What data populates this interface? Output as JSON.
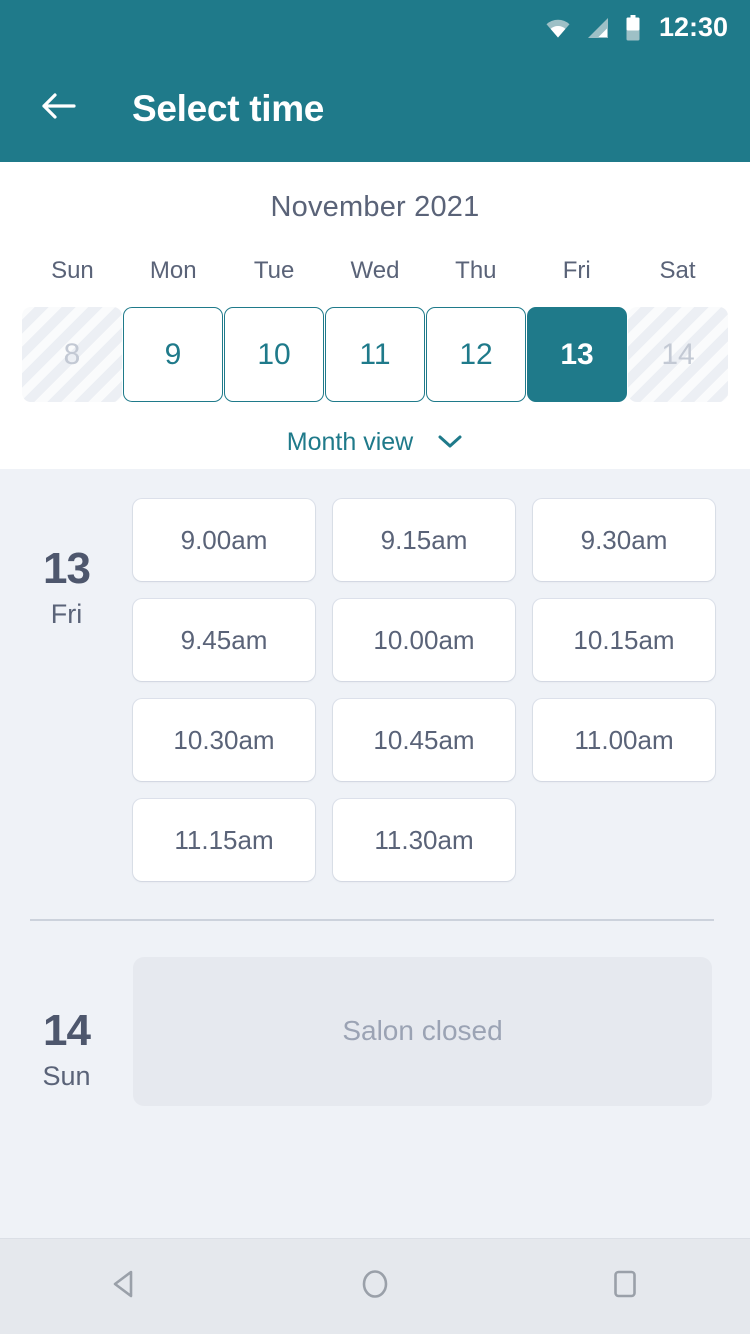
{
  "statusbar": {
    "time": "12:30",
    "icons": [
      "wifi-icon",
      "signal-icon",
      "battery-icon"
    ]
  },
  "appbar": {
    "back_icon": "back-arrow-icon",
    "title": "Select time"
  },
  "calendar": {
    "month_label": "November 2021",
    "weekday_headers": [
      "Sun",
      "Mon",
      "Tue",
      "Wed",
      "Thu",
      "Fri",
      "Sat"
    ],
    "days": [
      {
        "label": "8",
        "state": "unavailable"
      },
      {
        "label": "9",
        "state": "available"
      },
      {
        "label": "10",
        "state": "available"
      },
      {
        "label": "11",
        "state": "available"
      },
      {
        "label": "12",
        "state": "available"
      },
      {
        "label": "13",
        "state": "selected"
      },
      {
        "label": "14",
        "state": "unavailable"
      }
    ],
    "month_view_label": "Month view",
    "month_view_icon": "chevron-down-icon"
  },
  "schedule": [
    {
      "date_number": "13",
      "weekday": "Fri",
      "slots": [
        "9.00am",
        "9.15am",
        "9.30am",
        "9.45am",
        "10.00am",
        "10.15am",
        "10.30am",
        "10.45am",
        "11.00am",
        "11.15am",
        "11.30am"
      ]
    },
    {
      "date_number": "14",
      "weekday": "Sun",
      "closed_message": "Salon closed"
    }
  ],
  "navbar": {
    "back_label": "back-triangle-icon",
    "home_label": "home-circle-icon",
    "recents_label": "recents-square-icon"
  },
  "colors": {
    "accent": "#1f7a8a",
    "body_bg": "#eff2f7",
    "text_slate": "#5a6378",
    "muted": "#9ba3b4"
  }
}
